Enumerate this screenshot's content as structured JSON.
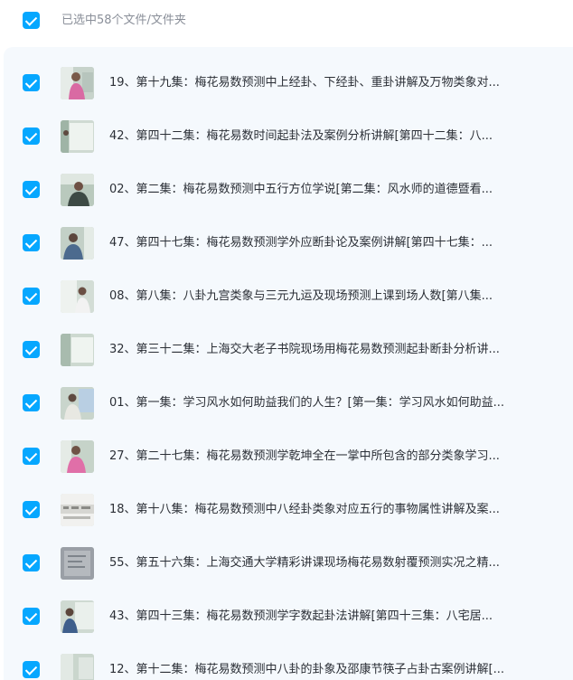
{
  "header": {
    "select_all_checked": true,
    "selection_text": "已选中58个文件/文件夹"
  },
  "colors": {
    "accent": "#06a7ff",
    "panel_background": "#f5f9fd",
    "title_text": "#2b2f36",
    "header_text": "#8a8f99"
  },
  "files": [
    {
      "title": "19、第十九集：梅花易数预测中上经卦、下经卦、重卦讲解及万物类象对...",
      "checked": true,
      "thumb_icon": "video-thumbnail-icon"
    },
    {
      "title": "42、第四十二集：梅花易数时间起卦法及案例分析讲解[第四十二集：八...",
      "checked": true,
      "thumb_icon": "video-thumbnail-icon"
    },
    {
      "title": "02、第二集：梅花易数预测中五行方位学说[第二集：风水师的道德暨看...",
      "checked": true,
      "thumb_icon": "video-thumbnail-icon"
    },
    {
      "title": "47、第四十七集：梅花易数预测学外应断卦论及案例讲解[第四十七集：...",
      "checked": true,
      "thumb_icon": "video-thumbnail-icon"
    },
    {
      "title": "08、第八集：八卦九宫类象与三元九运及现场预测上课到场人数[第八集...",
      "checked": true,
      "thumb_icon": "video-thumbnail-icon"
    },
    {
      "title": "32、第三十二集：上海交大老子书院现场用梅花易数预测起卦断卦分析讲...",
      "checked": true,
      "thumb_icon": "video-thumbnail-icon"
    },
    {
      "title": "01、第一集：学习风水如何助益我们的人生？[第一集：学习风水如何助益...",
      "checked": true,
      "thumb_icon": "video-thumbnail-icon"
    },
    {
      "title": "27、第二十七集：梅花易数预测学乾坤全在一掌中所包含的部分类象学习...",
      "checked": true,
      "thumb_icon": "video-thumbnail-icon"
    },
    {
      "title": "18、第十八集：梅花易数预测中八经卦类象对应五行的事物属性讲解及案...",
      "checked": true,
      "thumb_icon": "video-thumbnail-icon"
    },
    {
      "title": "55、第五十六集：上海交通大学精彩讲课现场梅花易数射覆预测实况之精...",
      "checked": true,
      "thumb_icon": "video-thumbnail-icon"
    },
    {
      "title": "43、第四十三集：梅花易数预测学字数起卦法讲解[第四十三集：八宅居...",
      "checked": true,
      "thumb_icon": "video-thumbnail-icon"
    },
    {
      "title": "12、第十二集：梅花易数预测中八卦的卦象及邵康节筷子占卦古案例讲解[...",
      "checked": true,
      "thumb_icon": "video-thumbnail-icon"
    }
  ]
}
